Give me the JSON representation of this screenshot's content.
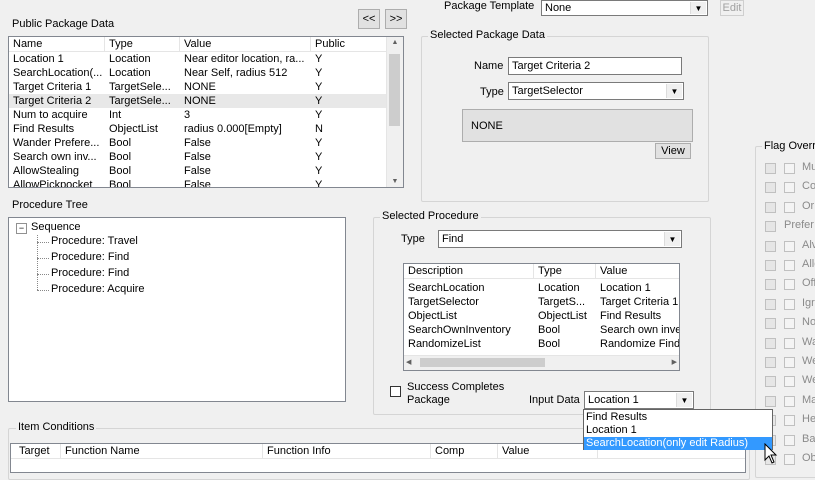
{
  "public_package": {
    "title": "Public Package Data",
    "nav_prev": "<<",
    "nav_next": ">>",
    "columns": [
      "Name",
      "Type",
      "Value",
      "Public"
    ],
    "rows": [
      {
        "name": "Location 1",
        "type": "Location",
        "value": "Near editor location, ra...",
        "public": "Y"
      },
      {
        "name": "SearchLocation(...",
        "type": "Location",
        "value": "Near Self, radius 512",
        "public": "Y"
      },
      {
        "name": "Target Criteria 1",
        "type": "TargetSele...",
        "value": " NONE",
        "public": "Y"
      },
      {
        "name": "Target Criteria 2",
        "type": "TargetSele...",
        "value": " NONE",
        "public": "Y"
      },
      {
        "name": "Num to acquire",
        "type": "Int",
        "value": "3",
        "public": "Y"
      },
      {
        "name": "Find Results",
        "type": "ObjectList",
        "value": "radius 0.000[Empty]",
        "public": "N"
      },
      {
        "name": "Wander Prefere...",
        "type": "Bool",
        "value": "False",
        "public": "Y"
      },
      {
        "name": "Search own inv...",
        "type": "Bool",
        "value": "False",
        "public": "Y"
      },
      {
        "name": "AllowStealing",
        "type": "Bool",
        "value": "False",
        "public": "Y"
      },
      {
        "name": "AllowPickpocket",
        "type": "Bool",
        "value": "False",
        "public": "Y"
      }
    ]
  },
  "package_template": {
    "label": "Package Template",
    "value": "None",
    "edit_label": "Edit"
  },
  "selected_package": {
    "title": "Selected Package Data",
    "name_label": "Name",
    "name_value": "Target Criteria 2",
    "type_label": "Type",
    "type_value": "TargetSelector",
    "display_value": "NONE",
    "view_label": "View"
  },
  "procedure_tree": {
    "title": "Procedure Tree",
    "root": "Sequence",
    "expander": "−",
    "items": [
      "Procedure: Travel",
      "Procedure: Find",
      "Procedure: Find",
      "Procedure: Acquire"
    ]
  },
  "selected_procedure": {
    "title": "Selected Procedure",
    "type_label": "Type",
    "type_value": "Find",
    "columns": [
      "Description",
      "Type",
      "Value"
    ],
    "rows": [
      {
        "desc": "SearchLocation",
        "type": "Location",
        "value": "Location 1"
      },
      {
        "desc": "TargetSelector",
        "type": "TargetS...",
        "value": "Target Criteria 1"
      },
      {
        "desc": "ObjectList",
        "type": "ObjectList",
        "value": "Find Results"
      },
      {
        "desc": "SearchOwnInventory",
        "type": "Bool",
        "value": "Search own inve"
      },
      {
        "desc": "RandomizeList",
        "type": "Bool",
        "value": "Randomize Find"
      }
    ],
    "success_label": "Success Completes Package",
    "input_data_label": "Input Data",
    "input_data_value": "Location 1",
    "dropdown_options": [
      "Find Results",
      "Location 1",
      "SearchLocation(only edit Radius)"
    ]
  },
  "flag_overrides": {
    "title": "Flag Overri",
    "items": [
      "Mu",
      "Co",
      "Or",
      "Prefer",
      "Alv",
      "Allo",
      "Off",
      "Igr",
      "No",
      "Wa",
      "We",
      "We",
      "Ma",
      "He",
      "Ba",
      "Ob"
    ],
    "prefer_index": 3
  },
  "item_conditions": {
    "title": "Item Conditions",
    "columns": [
      "Target",
      "Function Name",
      "Function Info",
      "Comp",
      "Value"
    ]
  }
}
